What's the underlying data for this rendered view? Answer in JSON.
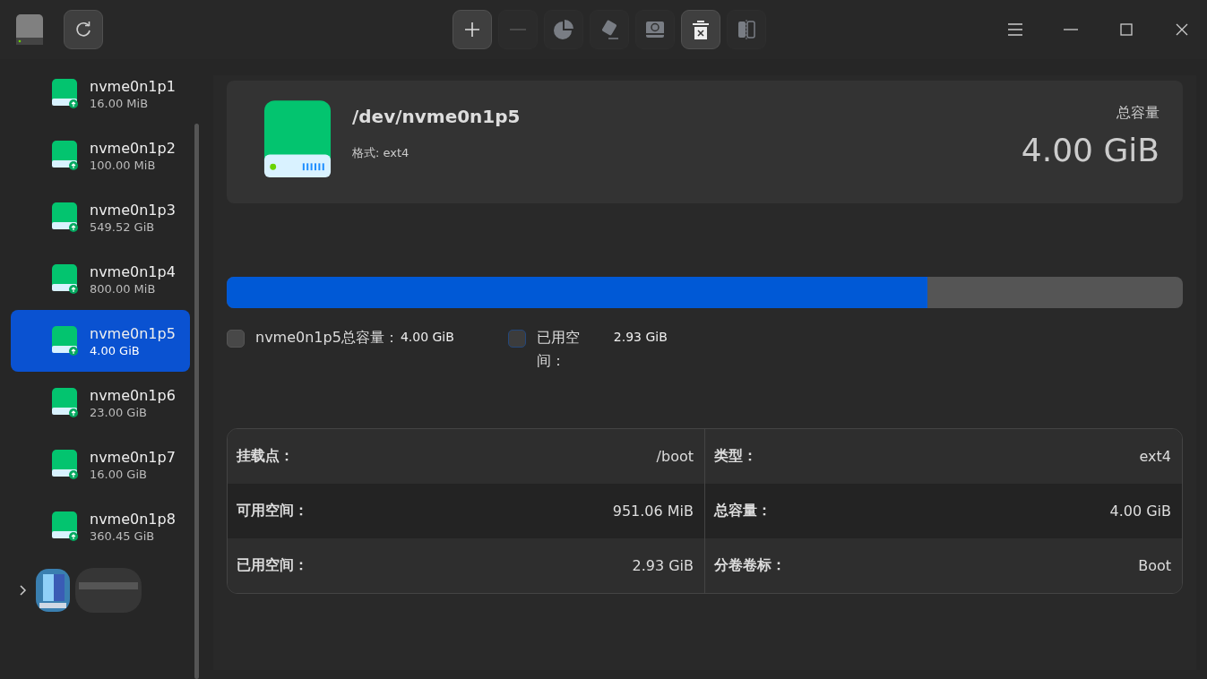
{
  "toolbar": {
    "buttons": [
      {
        "kind": "add",
        "disabled": false
      },
      {
        "kind": "remove",
        "disabled": true
      },
      {
        "kind": "partition",
        "disabled": true
      },
      {
        "kind": "erase",
        "disabled": true
      },
      {
        "kind": "restore",
        "disabled": true
      },
      {
        "kind": "delete",
        "disabled": false
      },
      {
        "kind": "split",
        "disabled": true
      }
    ]
  },
  "sidebar": {
    "items": [
      {
        "name": "nvme0n1p1",
        "size": "16.00 MiB",
        "selected": false
      },
      {
        "name": "nvme0n1p2",
        "size": "100.00 MiB",
        "selected": false
      },
      {
        "name": "nvme0n1p3",
        "size": "549.52 GiB",
        "selected": false
      },
      {
        "name": "nvme0n1p4",
        "size": "800.00 MiB",
        "selected": false
      },
      {
        "name": "nvme0n1p5",
        "size": "4.00 GiB",
        "selected": true
      },
      {
        "name": "nvme0n1p6",
        "size": "23.00 GiB",
        "selected": false
      },
      {
        "name": "nvme0n1p7",
        "size": "16.00 GiB",
        "selected": false
      },
      {
        "name": "nvme0n1p8",
        "size": "360.45 GiB",
        "selected": false
      }
    ],
    "collapsed_disk": {
      "expanded": false
    }
  },
  "header": {
    "path": "/dev/nvme0n1p5",
    "format": "格式: ext4",
    "capacity_label": "总容量",
    "capacity": "4.00 GiB"
  },
  "usage": {
    "level": 0.7325,
    "legend": [
      {
        "label": "nvme0n1p5总容量：",
        "value": "4.00 GiB",
        "color": "#484848"
      },
      {
        "label": "已用空间：",
        "value": "2.93 GiB",
        "color": "#3c3c3c"
      }
    ]
  },
  "details": {
    "rows": [
      [
        {
          "label": "挂载点：",
          "value": "/boot"
        },
        {
          "label": "类型：",
          "value": "ext4"
        }
      ],
      [
        {
          "label": "可用空间：",
          "value": "951.06 MiB"
        },
        {
          "label": "总容量：",
          "value": "4.00 GiB"
        }
      ],
      [
        {
          "label": "已用空间：",
          "value": "2.93 GiB"
        },
        {
          "label": "分卷卷标：",
          "value": "Boot"
        }
      ]
    ]
  }
}
